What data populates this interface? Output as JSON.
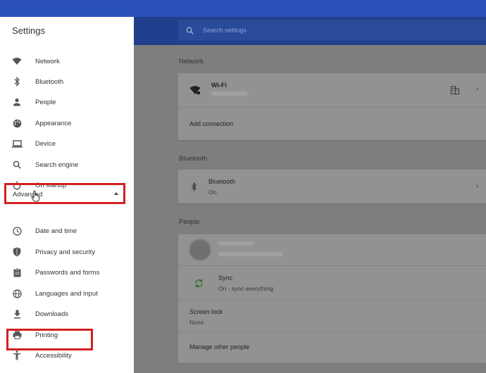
{
  "sidebar": {
    "title": "Settings",
    "items": [
      {
        "label": "Network",
        "icon": "wifi-icon"
      },
      {
        "label": "Bluetooth",
        "icon": "bluetooth-icon"
      },
      {
        "label": "People",
        "icon": "person-icon"
      },
      {
        "label": "Appearance",
        "icon": "palette-icon"
      },
      {
        "label": "Device",
        "icon": "laptop-icon"
      },
      {
        "label": "Search engine",
        "icon": "search-icon"
      },
      {
        "label": "On startup",
        "icon": "power-icon"
      }
    ],
    "advanced_label": "Advanced",
    "advanced_items": [
      {
        "label": "Date and time",
        "icon": "clock-icon"
      },
      {
        "label": "Privacy and security",
        "icon": "shield-icon"
      },
      {
        "label": "Passwords and forms",
        "icon": "clipboard-icon"
      },
      {
        "label": "Languages and input",
        "icon": "globe-icon"
      },
      {
        "label": "Downloads",
        "icon": "download-icon"
      },
      {
        "label": "Printing",
        "icon": "printer-icon"
      },
      {
        "label": "Accessibility",
        "icon": "accessibility-icon"
      }
    ]
  },
  "search": {
    "placeholder": "Search settings"
  },
  "sections": {
    "network": {
      "title": "Network",
      "wifi_label": "Wi-Fi",
      "add_connection": "Add connection"
    },
    "bluetooth": {
      "title": "Bluetooth",
      "label": "Bluetooth",
      "status": "On"
    },
    "people": {
      "title": "People",
      "sync_label": "Sync",
      "sync_status": "On - sync everything",
      "screen_lock_label": "Screen lock",
      "screen_lock_status": "None",
      "manage_people": "Manage other people"
    }
  },
  "colors": {
    "accent": "#2a52b8",
    "highlight_box": "#d32020"
  }
}
